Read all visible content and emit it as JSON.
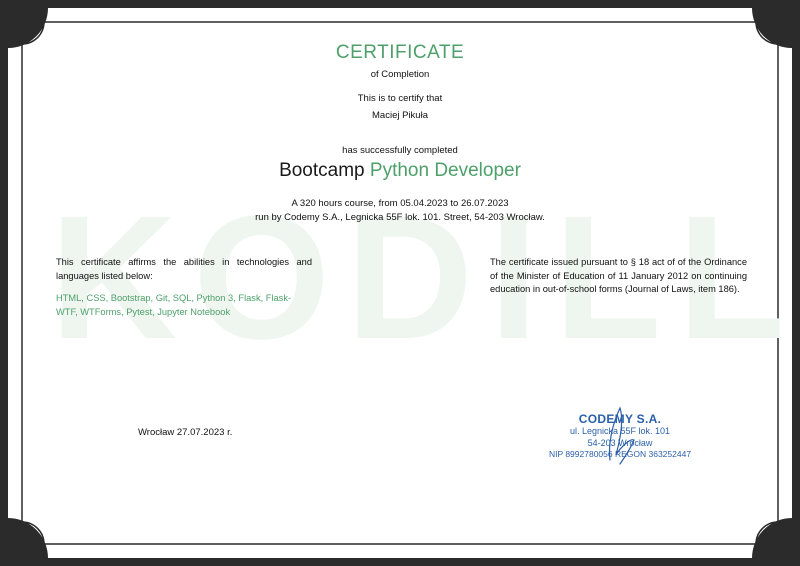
{
  "certificate": {
    "title": "CERTIFICATE",
    "subtitle": "of Completion",
    "certify_line": "This is to certify that",
    "recipient": "Maciej Pikuła",
    "completed_line": "has successfully completed",
    "course_prefix": "Bootcamp",
    "course_name": "Python Developer",
    "description_line1": "A 320 hours course, from 05.04.2023 to 26.07.2023",
    "description_line2": "run by Codemy S.A., Legnicka 55F lok. 101. Street, 54-203 Wrocław.",
    "left_text": "This certificate affirms the abilities in technologies and languages listed below:",
    "skills": "HTML, CSS, Bootstrap, Git, SQL, Python 3, Flask, Flask-WTF, WTForms, Pytest, Jupyter Notebook",
    "right_text": "The certificate issued pursuant to § 18 act of of the Ordinance of the Minister of Education of 11 January 2012 on continuing education in out-of-school forms (Journal of Laws, item 186).",
    "place_date": "Wrocław 27.07.2023 r.",
    "watermark": "KODILLA"
  },
  "stamp": {
    "company": "CODEMY S.A.",
    "street": "ul. Legnicka 55F lok. 101",
    "city": "54-203 Wrocław",
    "ids": "NIP 8992780056 REGON 363252447"
  },
  "colors": {
    "accent_green": "#4ea06a",
    "stamp_blue": "#2a5fa8",
    "frame_dark": "#2b2b2b"
  }
}
